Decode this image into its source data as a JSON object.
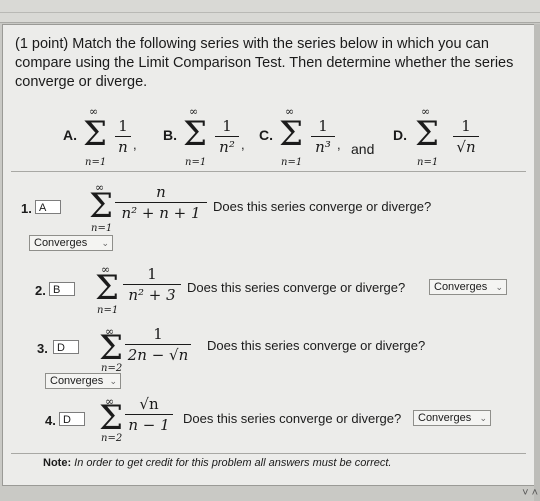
{
  "problem": {
    "points": "(1 point)",
    "text": "Match the following series with the series below in which you can compare using the Limit Comparison Test. Then determine whether the series converge or diverge."
  },
  "choices": [
    {
      "letter": "A.",
      "numerator": "1",
      "denominator": "n",
      "sep": ","
    },
    {
      "letter": "B.",
      "numerator": "1",
      "denominator": "n²",
      "sep": ","
    },
    {
      "letter": "C.",
      "numerator": "1",
      "denominator": "n³",
      "sep": ","
    },
    {
      "letter": "D.",
      "numerator": "1",
      "denominator": "√n",
      "sep": ""
    }
  ],
  "and_text": "and",
  "sigma": {
    "symbol": "Σ",
    "upper": "∞",
    "lower": "n=1"
  },
  "items": [
    {
      "label": "1.",
      "answer": "A",
      "upper": "∞",
      "lower": "n=1",
      "numerator": "n",
      "denominator": "n² + n + 1",
      "question": "Does this series converge or diverge?",
      "select": "Converges"
    },
    {
      "label": "2.",
      "answer": "B",
      "upper": "∞",
      "lower": "n=1",
      "numerator": "1",
      "denominator": "n² + 3",
      "question": "Does this series converge or diverge?",
      "select": "Converges"
    },
    {
      "label": "3.",
      "answer": "D",
      "upper": "∞",
      "lower": "n=2",
      "numerator": "1",
      "denominator": "2n − √n",
      "question": "Does this series converge or diverge?",
      "select": "Converges"
    },
    {
      "label": "4.",
      "answer": "D",
      "upper": "∞",
      "lower": "n=2",
      "numerator": "√n",
      "denominator": "n − 1",
      "question": "Does this series converge or diverge?",
      "select": "Converges"
    }
  ],
  "note": {
    "label": "Note:",
    "text": "In order to get credit for this problem all answers must be correct."
  },
  "icons": {
    "chevron": "chevron-down-icon"
  }
}
